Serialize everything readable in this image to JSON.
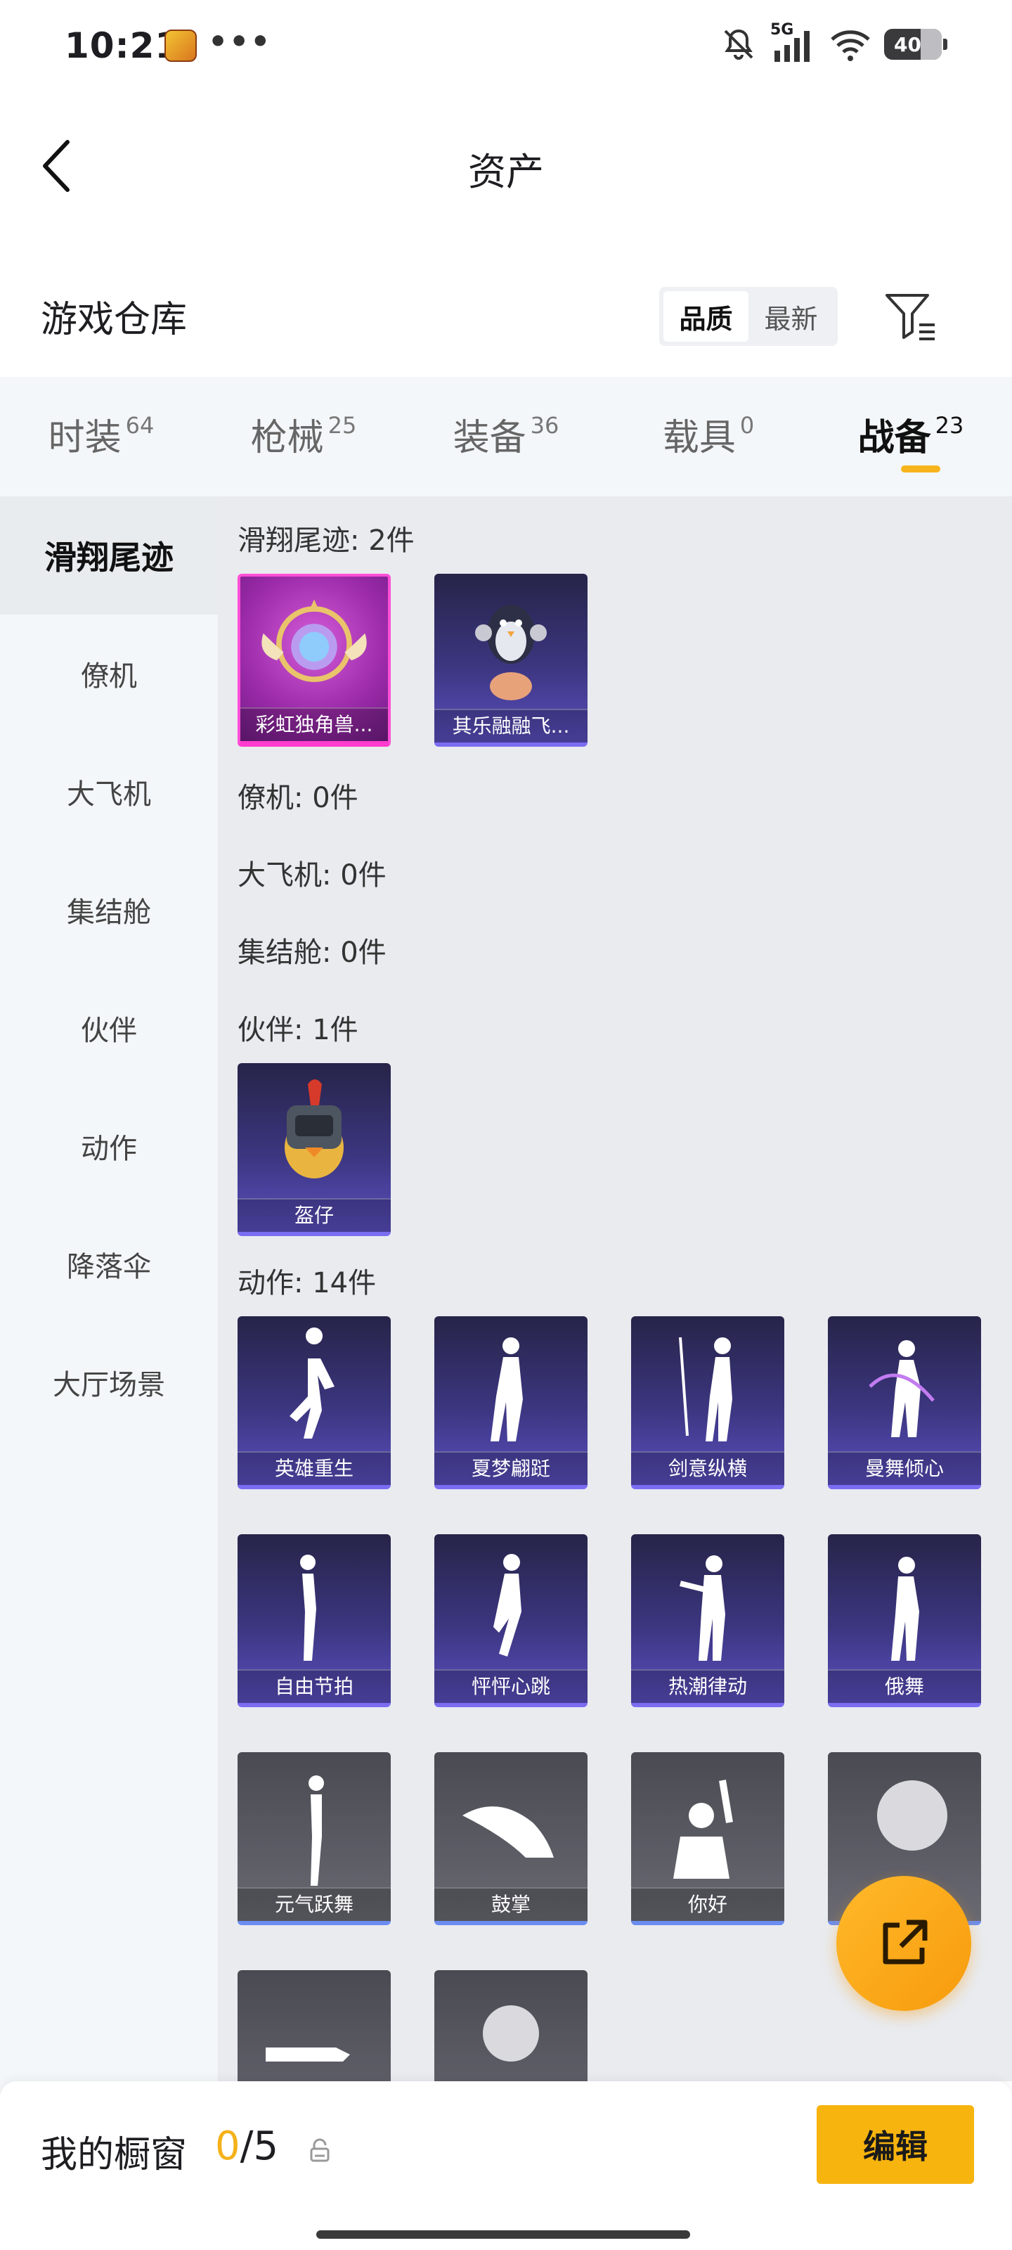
{
  "status_bar": {
    "time": "10:21",
    "dots": "•••",
    "network": "5G",
    "battery": "40"
  },
  "header": {
    "title": "资产"
  },
  "section": {
    "title": "游戏仓库",
    "sort_options": [
      "品质",
      "最新"
    ],
    "active_sort": "品质"
  },
  "tabs": [
    {
      "label": "时装",
      "count": "64"
    },
    {
      "label": "枪械",
      "count": "25"
    },
    {
      "label": "装备",
      "count": "36"
    },
    {
      "label": "载具",
      "count": "0"
    },
    {
      "label": "战备",
      "count": "23"
    }
  ],
  "active_tab": "战备",
  "sidebar": {
    "items": [
      "滑翔尾迹",
      "僚机",
      "大飞机",
      "集结舱",
      "伙伴",
      "动作",
      "降落伞",
      "大厅场景"
    ]
  },
  "groups": {
    "glide": {
      "header": "滑翔尾迹: 2件",
      "items": [
        {
          "name": "彩虹独角兽...",
          "style": "pink"
        },
        {
          "name": "其乐融融飞...",
          "style": "purple"
        }
      ]
    },
    "wingman": {
      "header": "僚机: 0件"
    },
    "plane": {
      "header": "大飞机: 0件"
    },
    "capsule": {
      "header": "集结舱: 0件"
    },
    "partner": {
      "header": "伙伴: 1件",
      "items": [
        {
          "name": "盔仔",
          "style": "purple"
        }
      ]
    },
    "emote": {
      "header": "动作: 14件",
      "items": [
        {
          "name": "英雄重生",
          "style": "purple"
        },
        {
          "name": "夏梦翩跹",
          "style": "purple"
        },
        {
          "name": "剑意纵横",
          "style": "purple"
        },
        {
          "name": "曼舞倾心",
          "style": "purple"
        },
        {
          "name": "自由节拍",
          "style": "purple"
        },
        {
          "name": "怦怦心跳",
          "style": "purple"
        },
        {
          "name": "热潮律动",
          "style": "purple"
        },
        {
          "name": "俄舞",
          "style": "purple"
        },
        {
          "name": "元气跃舞",
          "style": "gray"
        },
        {
          "name": "鼓掌",
          "style": "gray"
        },
        {
          "name": "你好",
          "style": "gray"
        },
        {
          "name": "",
          "style": "gray"
        },
        {
          "name": "",
          "style": "gray"
        },
        {
          "name": "",
          "style": "gray"
        }
      ]
    }
  },
  "bottom_bar": {
    "title": "我的橱窗",
    "current": "0",
    "total": "/5",
    "edit_label": "编辑"
  },
  "colors": {
    "accent": "#f7b40f",
    "tab_bg": "#f4f7f9",
    "content_bg": "#e9ebef"
  }
}
